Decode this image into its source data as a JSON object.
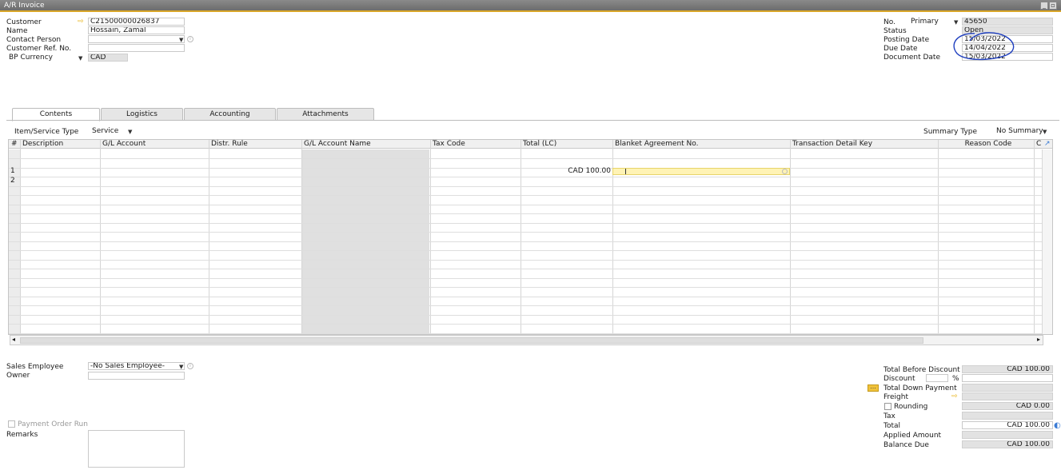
{
  "window": {
    "title": "A/R Invoice"
  },
  "header_left": {
    "customer_label": "Customer",
    "customer_value": "C21500000026837",
    "name_label": "Name",
    "name_value": "Hossain, Zamal",
    "contact_label": "Contact Person",
    "contact_value": "",
    "ref_label": "Customer Ref. No.",
    "ref_value": "",
    "currency_select": "BP Currency",
    "currency_value": "CAD"
  },
  "header_right": {
    "no_label": "No.",
    "series_value": "Primary",
    "no_value": "45650",
    "status_label": "Status",
    "status_value": "Open",
    "posting_label": "Posting Date",
    "posting_value": "15/03/2022",
    "due_label": "Due Date",
    "due_value": "14/04/2022",
    "docdate_label": "Document Date",
    "docdate_value": "15/03/2022"
  },
  "tabs": [
    {
      "label": "Contents"
    },
    {
      "label": "Logistics"
    },
    {
      "label": "Accounting"
    },
    {
      "label": "Attachments"
    }
  ],
  "contents": {
    "item_type_label": "Item/Service Type",
    "item_type_value": "Service",
    "summary_label": "Summary Type",
    "summary_value": "No Summary"
  },
  "grid": {
    "columns": [
      "#",
      "Description",
      "G/L Account",
      "Distr. Rule",
      "G/L Account Name",
      "Tax Code",
      "Total (LC)",
      "Blanket Agreement No.",
      "Transaction Detail Key",
      "Reason Code",
      "C"
    ],
    "rows": [
      {
        "num": "1",
        "total": "CAD 100.00"
      },
      {
        "num": "2",
        "total": ""
      }
    ]
  },
  "footer_left": {
    "sales_emp_label": "Sales Employee",
    "sales_emp_value": "-No Sales Employee-",
    "owner_label": "Owner",
    "owner_value": "",
    "payment_order_label": "Payment Order Run",
    "remarks_label": "Remarks"
  },
  "totals": {
    "before_discount_label": "Total Before Discount",
    "before_discount_value": "CAD 100.00",
    "discount_label": "Discount",
    "discount_pct": "%",
    "down_payment_label": "Total Down Payment",
    "freight_label": "Freight",
    "rounding_label": "Rounding",
    "rounding_value": "CAD 0.00",
    "tax_label": "Tax",
    "total_label": "Total",
    "total_value": "CAD 100.00",
    "applied_label": "Applied Amount",
    "balance_label": "Balance Due",
    "balance_value": "CAD 100.00"
  },
  "colors": {
    "accent": "#d9a628",
    "highlight": "#fff3b5",
    "annotation": "#1f3fbf"
  }
}
